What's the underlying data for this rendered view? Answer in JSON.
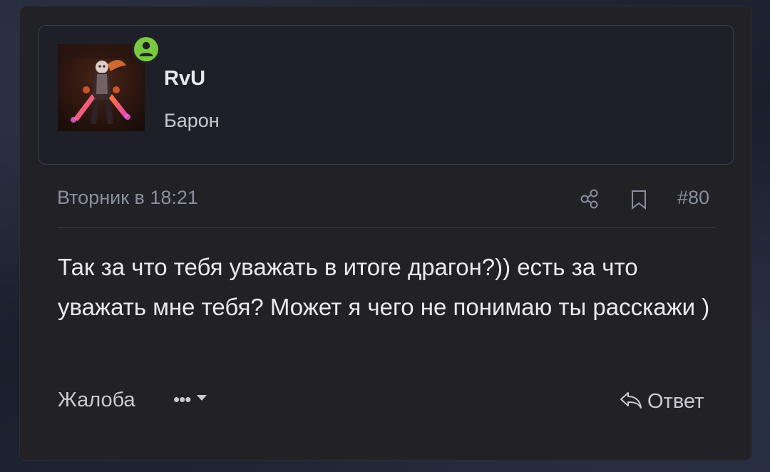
{
  "user": {
    "name": "RvU",
    "title": "Барон",
    "online": true
  },
  "post": {
    "date": "Вторник в 18:21",
    "number": "#80",
    "body": "Так за что тебя уважать в итоге драгон?)) есть за что уважать мне тебя? Может я чего не понимаю ты расскажи )"
  },
  "actions": {
    "report_label": "Жалоба",
    "more_label": "•••",
    "reply_label": "Ответ"
  },
  "icons": {
    "share": "share-icon",
    "bookmark": "bookmark-icon",
    "reply": "reply-arrow-icon",
    "online": "user-online-icon",
    "more_caret": "caret-down-icon"
  },
  "colors": {
    "card_background": "#212126",
    "online_badge": "#7ac943",
    "text_primary": "#e9e9ee",
    "text_muted": "#8b8e9d"
  }
}
